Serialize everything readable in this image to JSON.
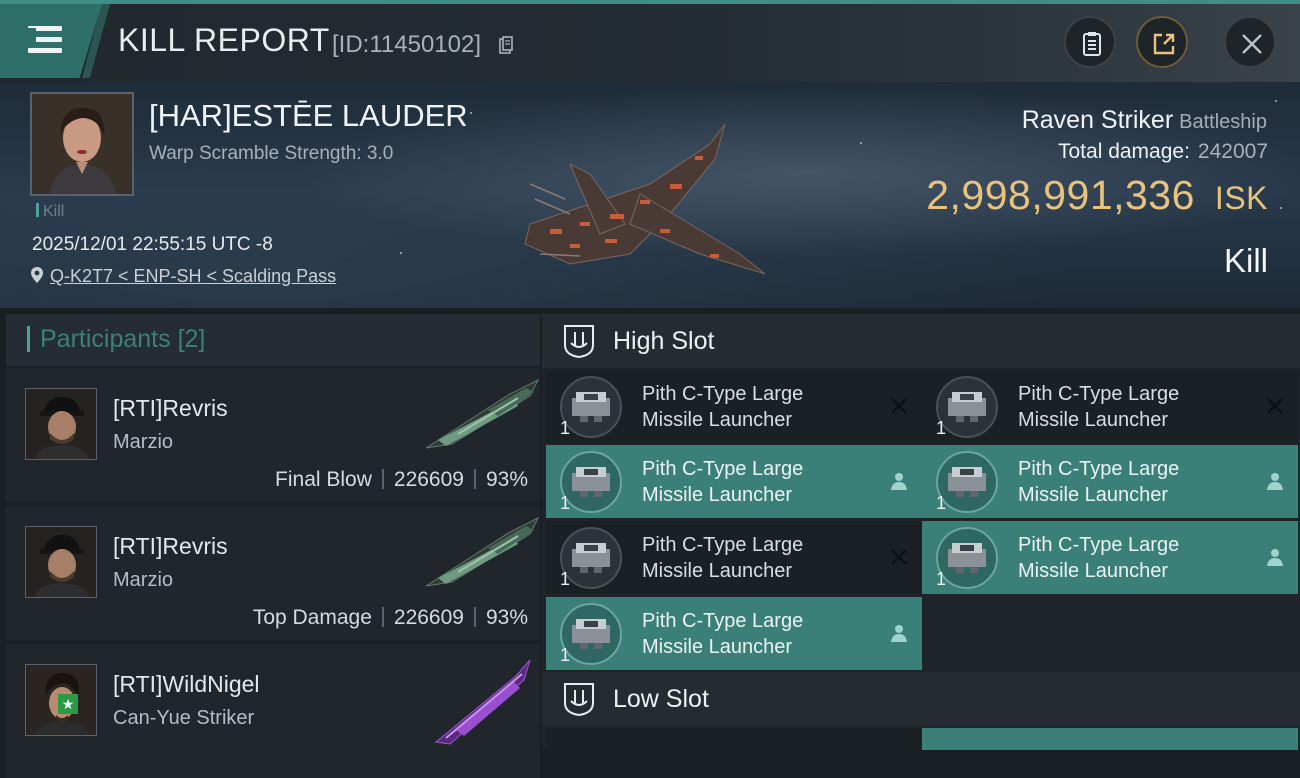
{
  "header": {
    "title": "KILL REPORT",
    "report_id": "[ID:11450102]",
    "buttons": [
      "clipboard-icon",
      "share-icon",
      "close-icon"
    ]
  },
  "victim": {
    "name": "[HAR]ESTĒE LAUDER",
    "warp_scramble": "Warp Scramble Strength: 3.0",
    "tag": "Kill",
    "datetime": "2025/12/01 22:55:15 UTC -8",
    "location": "Q-K2T7 < ENP-SH < Scalding Pass",
    "ship": "Raven Striker",
    "ship_class": "Battleship",
    "total_damage_label": "Total damage:",
    "total_damage": "242007",
    "isk_value": "2,998,991,336",
    "isk_unit": "ISK",
    "result": "Kill"
  },
  "participants": {
    "title": "Participants",
    "count": "[2]",
    "rows": [
      {
        "name": "[RTI]Revris",
        "ship": "Marzio",
        "role": "Final Blow",
        "damage": "226609",
        "percent": "93%"
      },
      {
        "name": "[RTI]Revris",
        "ship": "Marzio",
        "role": "Top Damage",
        "damage": "226609",
        "percent": "93%"
      },
      {
        "name": "[RTI]WildNigel",
        "ship": "Can-Yue Striker",
        "role": "",
        "damage": "",
        "percent": ""
      }
    ]
  },
  "fitting": {
    "high_slot_title": "High Slot",
    "low_slot_title": "Low Slot",
    "modules": [
      {
        "line1": "Pith C-Type Large",
        "line2": "Missile Launcher",
        "qty": "1",
        "state": "destroyed"
      },
      {
        "line1": "Pith C-Type Large",
        "line2": "Missile Launcher",
        "qty": "1",
        "state": "destroyed"
      },
      {
        "line1": "Pith C-Type Large",
        "line2": "Missile Launcher",
        "qty": "1",
        "state": "dropped"
      },
      {
        "line1": "Pith C-Type Large",
        "line2": "Missile Launcher",
        "qty": "1",
        "state": "dropped"
      },
      {
        "line1": "Pith C-Type Large",
        "line2": "Missile Launcher",
        "qty": "1",
        "state": "destroyed"
      },
      {
        "line1": "Pith C-Type Large",
        "line2": "Missile Launcher",
        "qty": "1",
        "state": "dropped"
      },
      {
        "line1": "Pith C-Type Large",
        "line2": "Missile Launcher",
        "qty": "1",
        "state": "dropped"
      }
    ]
  },
  "colors": {
    "accent_teal": "#3b7f79",
    "isk_gold": "#e9c27c",
    "participants_title": "#3d7f79"
  }
}
